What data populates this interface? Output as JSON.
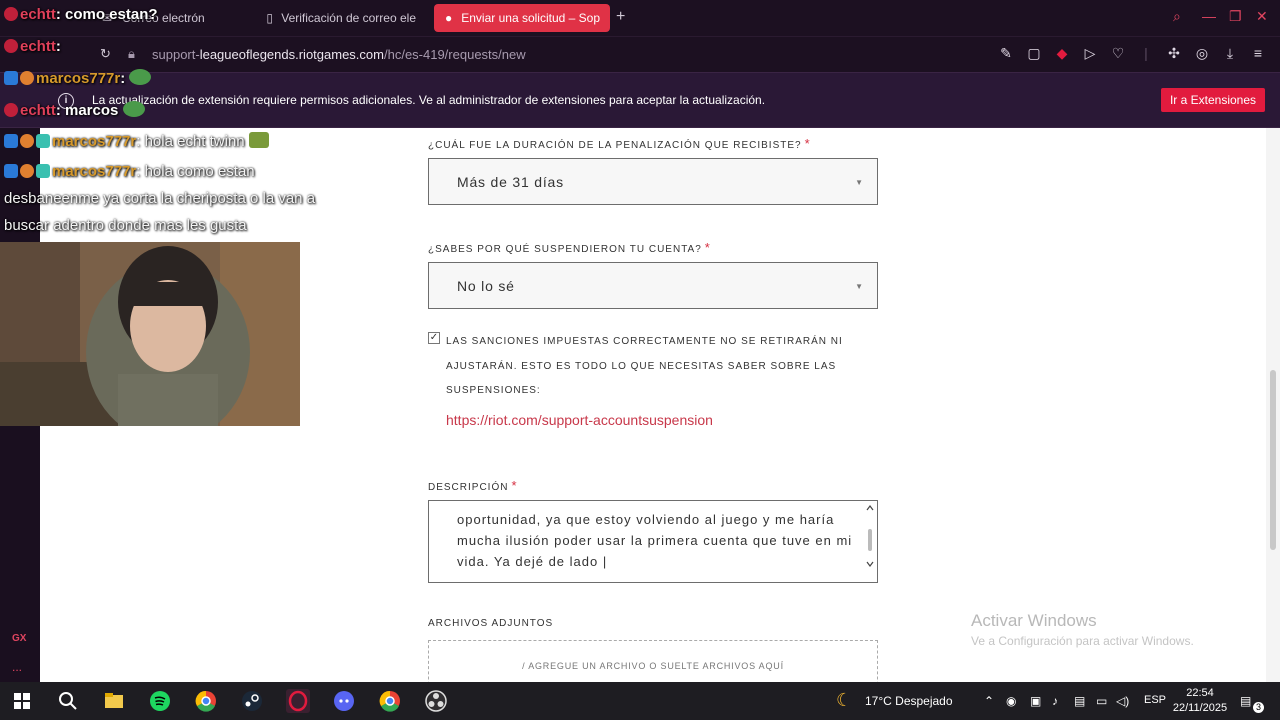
{
  "tabs": [
    {
      "label": "Correo electrón",
      "active": false
    },
    {
      "label": "Verificación de correo ele",
      "active": false
    },
    {
      "label": "Enviar una solicitud – Sop",
      "active": true
    }
  ],
  "address": {
    "prefix": "support-",
    "domain": "leagueoflegends.riotgames.com",
    "path": "/hc/es-419/requests/new"
  },
  "notification": {
    "text": "La actualización de extensión requiere permisos adicionales. Ve al administrador de extensiones para aceptar la actualización.",
    "button": "Ir a Extensiones"
  },
  "form": {
    "penalty_label": "¿CUÁL FUE LA DURACIÓN DE LA PENALIZACIÓN QUE RECIBISTE?",
    "penalty_value": "Más de 31 días",
    "reason_label": "¿SABES POR QUÉ SUSPENDIERON TU CUENTA?",
    "reason_value": "No lo sé",
    "checkbox_text": "LAS SANCIONES IMPUESTAS CORRECTAMENTE NO SE RETIRARÁN NI AJUSTARÁN. ESTO ES TODO LO QUE NECESITAS SABER SOBRE LAS SUSPENSIONES:",
    "link": "https://riot.com/support-accountsuspension",
    "description_label": "DESCRIPCIÓN",
    "description_text": "oportunidad, ya que estoy volviendo al juego y me haría mucha ilusión poder usar la primera cuenta que tuve en mi vida. Ya dejé de lado |",
    "attachments_label": "ARCHIVOS ADJUNTOS",
    "dropzone_text": "/ AGREGUE UN ARCHIVO O SUELTE ARCHIVOS AQUÍ",
    "required_mark": "*"
  },
  "watermark": {
    "title": "Activar Windows",
    "subtitle": "Ve a Configuración para activar Windows."
  },
  "chat": [
    {
      "user": "echtt",
      "msg": ": como estan?"
    },
    {
      "user": "echtt",
      "msg": ":"
    },
    {
      "user": "marcos777r",
      "msg": ":"
    },
    {
      "user": "echtt",
      "msg": ": marcos"
    },
    {
      "user": "marcos777r",
      "msg": ": hola echt twinn"
    },
    {
      "user": "marcos777r",
      "msg": ": hola como estan"
    },
    {
      "user": "",
      "msg": "desbaneenme ya corta la cheriposta o la van a"
    },
    {
      "user": "",
      "msg": "buscar adentro donde mas les gusta"
    }
  ],
  "sidebar": {
    "badge": "GX",
    "more": "..."
  },
  "taskbar": {
    "weather": "17°C  Despejado",
    "lang": "ESP",
    "time": "22:54",
    "date": "22/11/2025",
    "notif_count": "3"
  },
  "colors": {
    "accent": "#e21b3e",
    "chrome_bg": "#1c1021",
    "link": "#c8384a",
    "required": "#d42d3f",
    "chat_user": "#d79a2c"
  }
}
